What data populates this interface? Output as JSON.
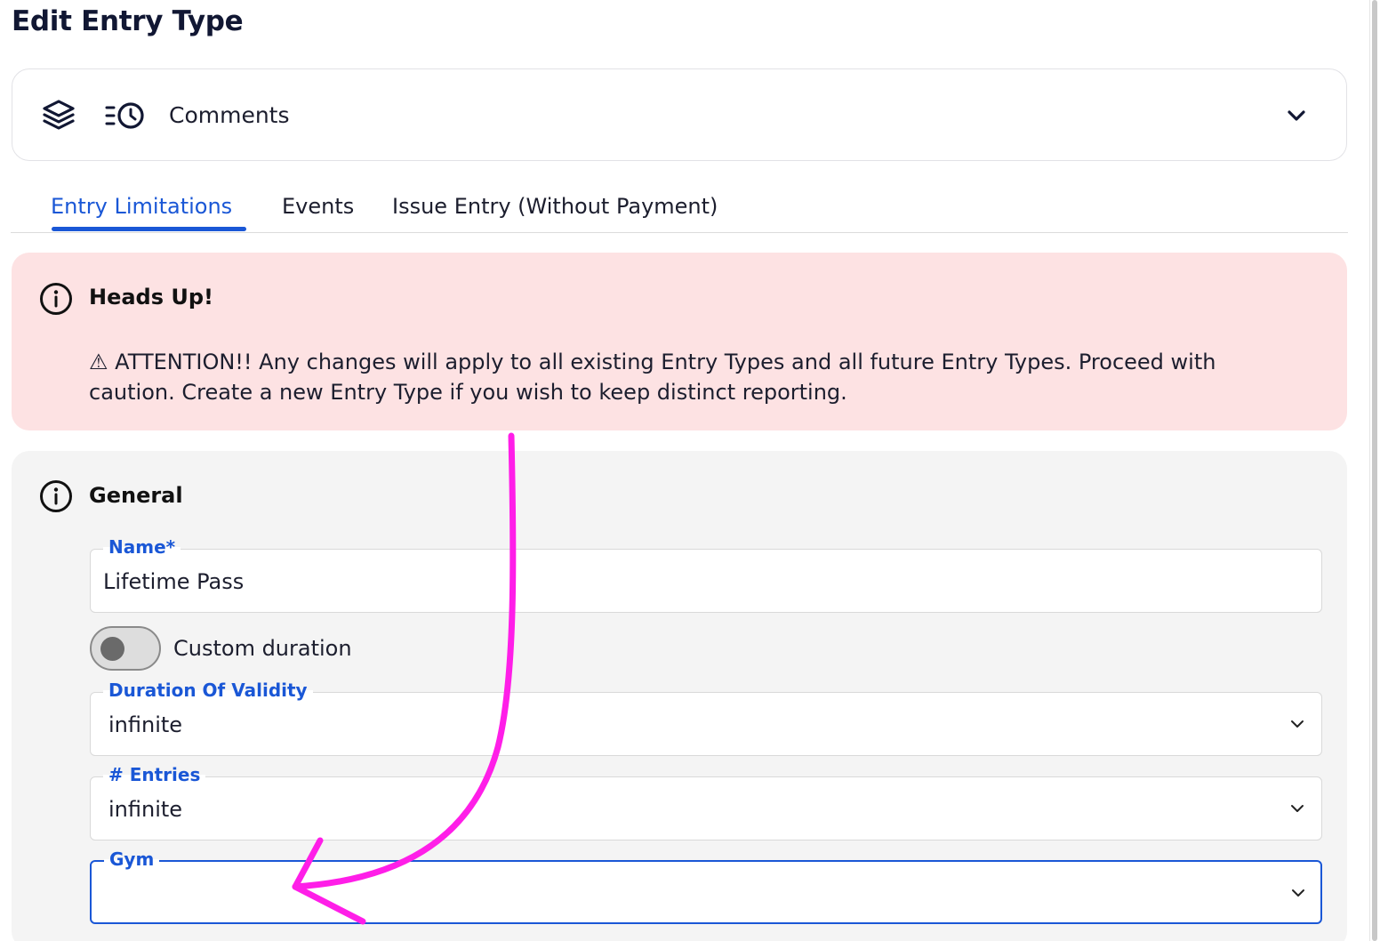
{
  "page": {
    "title": "Edit Entry Type"
  },
  "selector": {
    "label": "Comments",
    "icons": [
      "layers-icon",
      "history-icon",
      "chevron-down-icon"
    ]
  },
  "tabs": [
    {
      "label": "Entry Limitations",
      "active": true
    },
    {
      "label": "Events",
      "active": false
    },
    {
      "label": "Issue Entry (Without Payment)",
      "active": false
    }
  ],
  "alert": {
    "title": "Heads Up!",
    "body": "⚠ ATTENTION!! Any changes will apply to all existing Entry Types and all future Entry Types. Proceed with caution. Create a new Entry Type if you wish to keep distinct reporting.",
    "background": "#fde2e3"
  },
  "general": {
    "title": "General",
    "name_field": {
      "label": "Name*",
      "value": "Lifetime Pass"
    },
    "custom_duration": {
      "label": "Custom duration",
      "enabled": false
    },
    "duration_field": {
      "label": "Duration Of Validity",
      "value": "infinite"
    },
    "entries_field": {
      "label": "# Entries",
      "value": "infinite"
    },
    "gym_field": {
      "label": "Gym",
      "value": "",
      "focused": true
    }
  },
  "colors": {
    "accent": "#1a57d6",
    "annotation_arrow": "#ff1ee8"
  }
}
